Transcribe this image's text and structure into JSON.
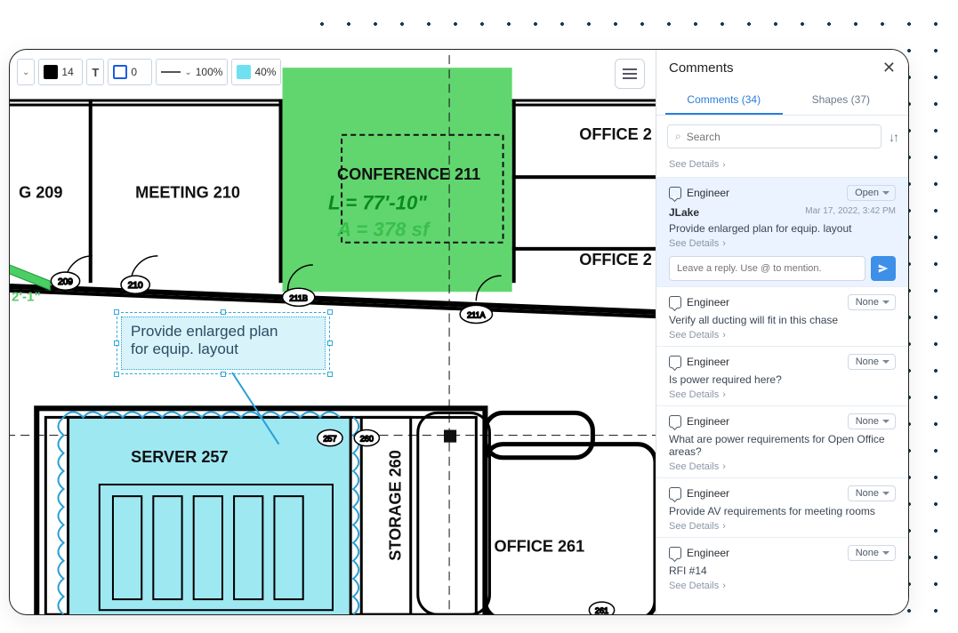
{
  "toolbar": {
    "font_size": "14",
    "stroke_width": "0",
    "line_scale": "100%",
    "fill_opacity": "40%"
  },
  "rooms": {
    "g209": "G  209",
    "meeting210": "MEETING  210",
    "conference211": "CONFERENCE  211",
    "office_top": "OFFICE  2",
    "office_mid": "OFFICE  2",
    "server257": "SERVER  257",
    "storage260": "STORAGE  260",
    "office261": "OFFICE  261"
  },
  "doors": {
    "d209": "209",
    "d210": "210",
    "d211b": "211B",
    "d211a": "211A",
    "d257": "257",
    "d260": "260",
    "d261": "261"
  },
  "measurements": {
    "length": "L = 77'-10\"",
    "area": "A = 378 sf",
    "dim_left": "2'-1\""
  },
  "callout": {
    "text_line1": "Provide enlarged plan",
    "text_line2": "for equip. layout"
  },
  "panel": {
    "title": "Comments",
    "tabs": {
      "comments": "Comments (34)",
      "shapes": "Shapes (37)"
    },
    "search_placeholder": "Search",
    "see_details": "See Details",
    "reply_placeholder": "Leave a reply. Use @ to mention.",
    "items": [
      {
        "role": "Engineer",
        "status": "Open",
        "author": "JLake",
        "timestamp": "Mar 17, 2022, 3:42 PM",
        "text": "Provide enlarged plan for equip. layout",
        "highlighted": true,
        "show_reply": true
      },
      {
        "role": "Engineer",
        "status": "None",
        "text": "Verify all ducting will fit in this chase"
      },
      {
        "role": "Engineer",
        "status": "None",
        "text": "Is power required here?"
      },
      {
        "role": "Engineer",
        "status": "None",
        "text": "What are power requirements for Open Office areas?"
      },
      {
        "role": "Engineer",
        "status": "None",
        "text": "Provide AV requirements for meeting rooms"
      },
      {
        "role": "Engineer",
        "status": "None",
        "text": "RFI #14"
      }
    ]
  }
}
